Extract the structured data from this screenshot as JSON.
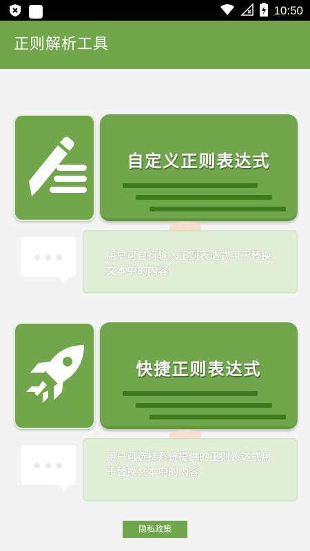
{
  "status_bar": {
    "time": "10:50",
    "icons": [
      "shield-icon",
      "notification-square-icon",
      "wifi-icon",
      "signal-icon",
      "battery-charging-icon"
    ]
  },
  "app_bar": {
    "title": "正则解析工具"
  },
  "features": [
    {
      "icon": "pencil-icon",
      "title": "自定义正则表达式",
      "description": "用户可自行输入正则表达式用于替换文本中的内容"
    },
    {
      "icon": "rocket-icon",
      "title": "快捷正则表达式",
      "description": "用户可选择系统提供的正则表达式用于替换文本中的内容"
    }
  ],
  "footer": {
    "privacy_label": "隐私政策"
  },
  "colors": {
    "primary": "#6fa74a",
    "primary_dark": "#3e7a22",
    "card_bg": "#e2efd7",
    "page_bg": "#f4f4f4"
  }
}
